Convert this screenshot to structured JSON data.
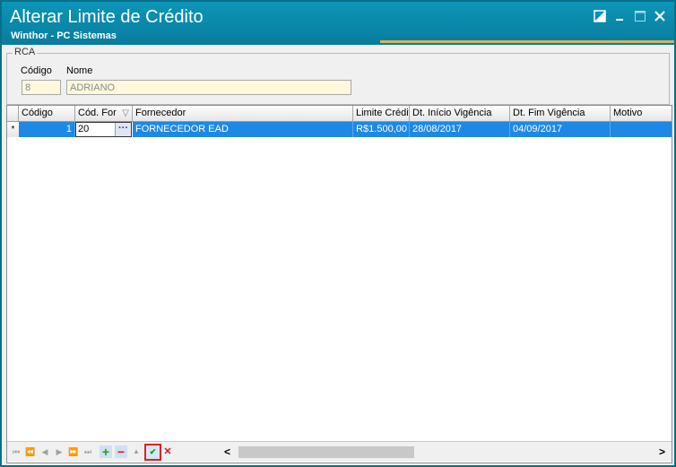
{
  "window": {
    "title": "Alterar Limite de Crédito",
    "subtitle": "Winthor - PC Sistemas"
  },
  "rca": {
    "group_label": "RCA",
    "codigo_label": "Código",
    "nome_label": "Nome",
    "codigo_value": "8",
    "nome_value": "ADRIANO"
  },
  "grid": {
    "columns": [
      "Código",
      "Cód. For",
      "Fornecedor",
      "Limite Crédit",
      "Dt. Início Vigência",
      "Dt. Fim Vigência",
      "Motivo"
    ],
    "row_indicator": "*",
    "rows": [
      {
        "codigo": "1",
        "cod_for": "20",
        "fornecedor": "FORNECEDOR EAD",
        "limite": "R$1.500,00",
        "dt_inicio": "28/08/2017",
        "dt_fim": "04/09/2017",
        "motivo": ""
      }
    ],
    "ellipsis": "···",
    "filter_icon": "▽"
  },
  "navigator": {
    "first": "⏮",
    "prev_page": "⏪",
    "prev": "◀",
    "next": "▶",
    "next_page": "⏩",
    "last": "⏭",
    "add": "+",
    "delete": "−",
    "up": "▲",
    "post": "✔",
    "cancel": "✕",
    "scroll_left": "<",
    "scroll_right": ">"
  },
  "colors": {
    "titlebar": "#0a86a8",
    "accent": "#d4b25b",
    "selection": "#1e88e5",
    "field_bg": "#fff8dc"
  }
}
